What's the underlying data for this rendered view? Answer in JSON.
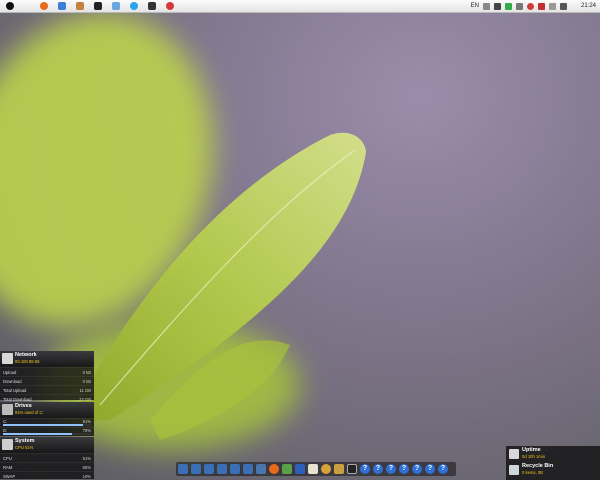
{
  "menubar": {
    "app_icons": [
      "apple-icon",
      "firefox-icon",
      "music-icon",
      "tool-icon",
      "terminal-icon",
      "finder-icon",
      "skype-icon",
      "app-icon",
      "record-icon"
    ],
    "language": "EN",
    "clock": "21:24"
  },
  "network_widget": {
    "title": "Network",
    "ip": "93.100.89.68",
    "rows": [
      {
        "label": "Upload",
        "value": "0 kB"
      },
      {
        "label": "Download",
        "value": "0 kB"
      },
      {
        "label": "Total Upload",
        "value": "11 GB"
      },
      {
        "label": "Total Download",
        "value": "22 GB"
      }
    ]
  },
  "drives_widget": {
    "title": "Drives",
    "subtitle": "91% used of C:",
    "rows": [
      {
        "label": "C:",
        "value": "91%",
        "fill": 0.91
      },
      {
        "label": "D:",
        "value": "78%",
        "fill": 0.78
      }
    ]
  },
  "system_widget": {
    "title": "System",
    "subtitle": "CPU 51%",
    "rows": [
      {
        "label": "CPU",
        "value": "51%"
      },
      {
        "label": "RAM",
        "value": "55%"
      },
      {
        "label": "SWAP",
        "value": "10%"
      }
    ]
  },
  "dock": {
    "items": [
      "folder-icon",
      "folder-icon",
      "folder-icon",
      "folder-icon",
      "folder-icon",
      "folder-icon",
      "calculator-icon",
      "firefox-icon",
      "notepad-icon",
      "word-icon",
      "text-icon",
      "paint-icon",
      "broom-icon",
      "terminal-icon"
    ],
    "help_label": "?",
    "help_count": 7
  },
  "uptime_widget": {
    "title": "Uptime",
    "value": "0d 10h 1min"
  },
  "recycle_widget": {
    "title": "Recycle Bin",
    "value": "0 items, 0B"
  }
}
